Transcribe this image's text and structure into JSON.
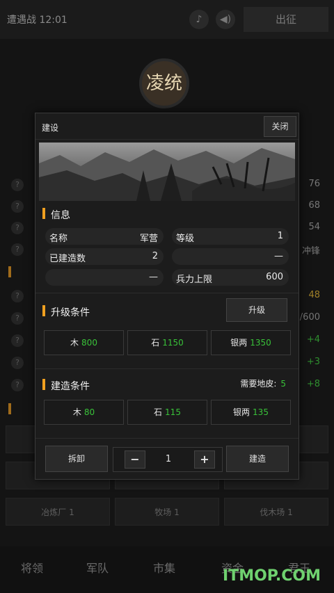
{
  "background": {
    "title": "遭遇战 12:01",
    "depart_label": "出征",
    "emblem_char": "凌统",
    "right_values": [
      "76",
      "68",
      "54",
      "冲锋",
      "48",
      "/600",
      "+4",
      "+3",
      "+8"
    ],
    "cells": [
      "冶炼厂 1",
      "牧场 1",
      "伐木场 1"
    ],
    "nav": [
      "将领",
      "军队",
      "市集",
      "资金",
      "君王"
    ]
  },
  "dialog": {
    "title": "建设",
    "close_label": "关闭",
    "info": {
      "section_label": "信息",
      "name_key": "名称",
      "name_value": "军营",
      "level_key": "等级",
      "level_value": "1",
      "built_key": "已建造数",
      "built_value": "2",
      "blank_value_1": "—",
      "blank_value_2": "—",
      "troop_key": "兵力上限",
      "troop_value": "600"
    },
    "upgrade": {
      "section_label": "升级条件",
      "button_label": "升级",
      "costs": [
        {
          "label": "木",
          "value": "800"
        },
        {
          "label": "石",
          "value": "1150"
        },
        {
          "label": "银两",
          "value": "1350"
        }
      ]
    },
    "build": {
      "section_label": "建造条件",
      "land_label": "需要地皮:",
      "land_value": "5",
      "costs": [
        {
          "label": "木",
          "value": "80"
        },
        {
          "label": "石",
          "value": "115"
        },
        {
          "label": "银两",
          "value": "135"
        }
      ]
    },
    "actions": {
      "demolish_label": "拆卸",
      "minus_label": "−",
      "quantity": "1",
      "plus_label": "+",
      "build_label": "建造"
    }
  },
  "watermark": "ITMOP.COM",
  "colors": {
    "accent": "#f0a020",
    "green": "#39c239",
    "panel": "#1c1c1c"
  }
}
